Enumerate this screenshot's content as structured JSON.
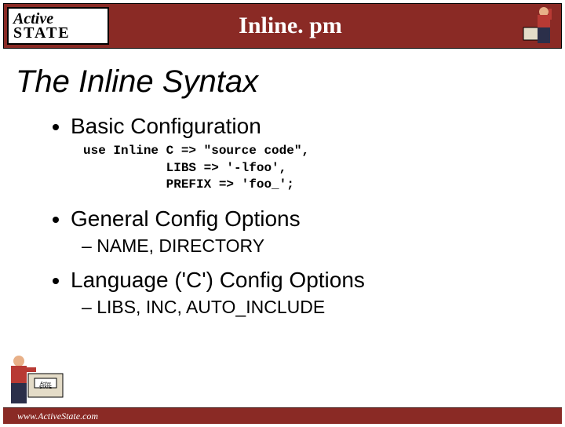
{
  "header": {
    "logo_top": "Active",
    "logo_bottom": "STATE",
    "title": "Inline. pm"
  },
  "slide": {
    "title": "The Inline Syntax",
    "bullets": {
      "b1": "Basic Configuration",
      "code": "use Inline C => \"source code\",\n           LIBS => '-lfoo',\n           PREFIX => 'foo_';",
      "b2": "General Config Options",
      "b2_sub": "NAME, DIRECTORY",
      "b3": "Language ('C') Config Options",
      "b3_sub": "LIBS, INC, AUTO_INCLUDE"
    }
  },
  "footer": {
    "url": "www.ActiveState.com"
  }
}
